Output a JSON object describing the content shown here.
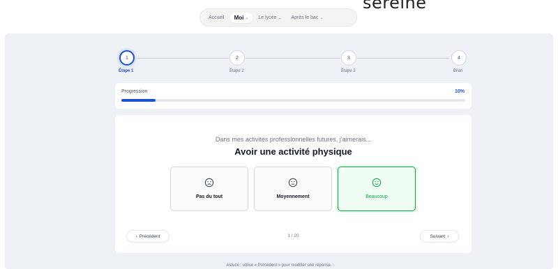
{
  "hero": {
    "title": "sereine"
  },
  "nav": {
    "items": [
      {
        "label": "Accueil",
        "caret": ""
      },
      {
        "label": "Moi",
        "caret": "⌄"
      },
      {
        "label": "Le lycée",
        "caret": "⌄"
      },
      {
        "label": "Après le bac",
        "caret": "⌄"
      }
    ],
    "active_index": 1
  },
  "stepper": {
    "steps": [
      {
        "number": "1",
        "label": "Étape 1"
      },
      {
        "number": "2",
        "label": "Étape 2"
      },
      {
        "number": "3",
        "label": "Étape 3"
      },
      {
        "number": "4",
        "label": "Bilan"
      }
    ],
    "current_index": 0
  },
  "progress": {
    "label": "Progression",
    "percent_text": "10%",
    "value": 0.1
  },
  "question": {
    "prompt": "Dans mes activités professionnelles futures, j'aimerais...",
    "title": "Avoir une activité physique",
    "options": [
      {
        "label": "Pas du tout",
        "icon": "frown-face-icon"
      },
      {
        "label": "Moyennement",
        "icon": "neutral-face-icon"
      },
      {
        "label": "Beaucoup",
        "icon": "smile-face-icon"
      }
    ],
    "selected_index": 2
  },
  "navigation": {
    "prev_label": "Précédent",
    "next_label": "Suivant",
    "counter": "1 / 20"
  },
  "footer": {
    "hint": "Astuce : utilise « Précédent » pour modifier une réponse."
  },
  "colors": {
    "accent": "#1d4ed8",
    "selected": "#16a34a",
    "panel": "#eef2f7"
  }
}
